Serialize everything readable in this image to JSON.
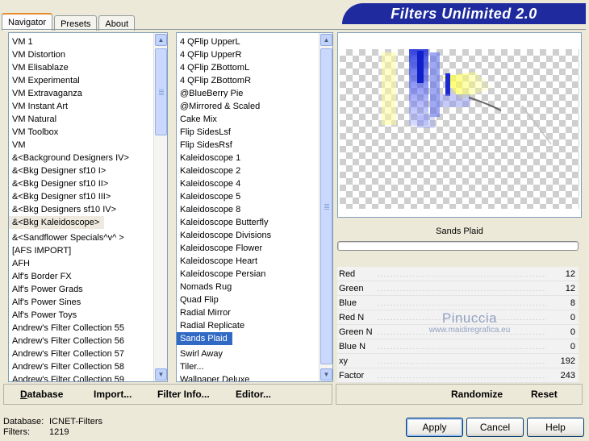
{
  "tabs": [
    {
      "label": "Navigator",
      "active": true
    },
    {
      "label": "Presets",
      "active": false
    },
    {
      "label": "About",
      "active": false
    }
  ],
  "app_title": "Filters Unlimited 2.0",
  "categories": [
    "VM 1",
    "VM Distortion",
    "VM Elisablaze",
    "VM Experimental",
    "VM Extravaganza",
    "VM Instant Art",
    "VM Natural",
    "VM Toolbox",
    "VM",
    "&<Background Designers IV>",
    "&<Bkg Designer sf10 I>",
    "&<Bkg Designer sf10 II>",
    "&<Bkg Designer sf10 III>",
    "&<Bkg Designers sf10 IV>",
    "&<Bkg Kaleidoscope>",
    "&<Sandflower Specials^v^ >",
    "[AFS IMPORT]",
    "AFH",
    "Alf's Border FX",
    "Alf's Power Grads",
    "Alf's Power Sines",
    "Alf's Power Toys",
    "Andrew's Filter Collection 55",
    "Andrew's Filter Collection 56",
    "Andrew's Filter Collection 57",
    "Andrew's Filter Collection 58",
    "Andrew's Filter Collection 59"
  ],
  "selected_category": "&<Bkg Kaleidoscope>",
  "filters": [
    "4 QFlip UpperL",
    "4 QFlip UpperR",
    "4 QFlip ZBottomL",
    "4 QFlip ZBottomR",
    "@BlueBerry Pie",
    "@Mirrored & Scaled",
    "Cake Mix",
    "Flip SidesLsf",
    "Flip SidesRsf",
    "Kaleidoscope 1",
    "Kaleidoscope 2",
    "Kaleidoscope 4",
    "Kaleidoscope 5",
    "Kaleidoscope 8",
    "Kaleidoscope Butterfly",
    "Kaleidoscope Divisions",
    "Kaleidoscope Flower",
    "Kaleidoscope Heart",
    "Kaleidoscope Persian",
    "Nomads Rug",
    "Quad Flip",
    "Radial Mirror",
    "Radial Replicate",
    "Sands Plaid",
    "Swirl Away",
    "Tiler...",
    "Wallpaper Deluxe"
  ],
  "selected_filter": "Sands Plaid",
  "filter_name": "Sands Plaid",
  "progress": 0,
  "params": [
    {
      "label": "Red",
      "value": "12"
    },
    {
      "label": "Green",
      "value": "12"
    },
    {
      "label": "Blue",
      "value": "8"
    },
    {
      "label": "Red N",
      "value": "0"
    },
    {
      "label": "Green N",
      "value": "0"
    },
    {
      "label": "Blue N",
      "value": "0"
    },
    {
      "label": "xy",
      "value": "192"
    },
    {
      "label": "Factor",
      "value": "243"
    }
  ],
  "watermark": {
    "line1": "Pinuccia",
    "line2": "www.maidiregrafica.eu"
  },
  "left_toolbar": {
    "database": "Database",
    "import": "Import...",
    "filter_info": "Filter Info...",
    "editor": "Editor..."
  },
  "right_toolbar": {
    "randomize": "Randomize",
    "reset": "Reset"
  },
  "status": {
    "database_label": "Database:",
    "database_value": "ICNET-Filters",
    "filters_label": "Filters:",
    "filters_value": "1219"
  },
  "buttons": {
    "apply": "Apply",
    "cancel": "Cancel",
    "help": "Help"
  },
  "colors": {
    "accent": "#316ac5",
    "banner": "#1e2a9e",
    "tab_highlight": "#e68b2c"
  }
}
